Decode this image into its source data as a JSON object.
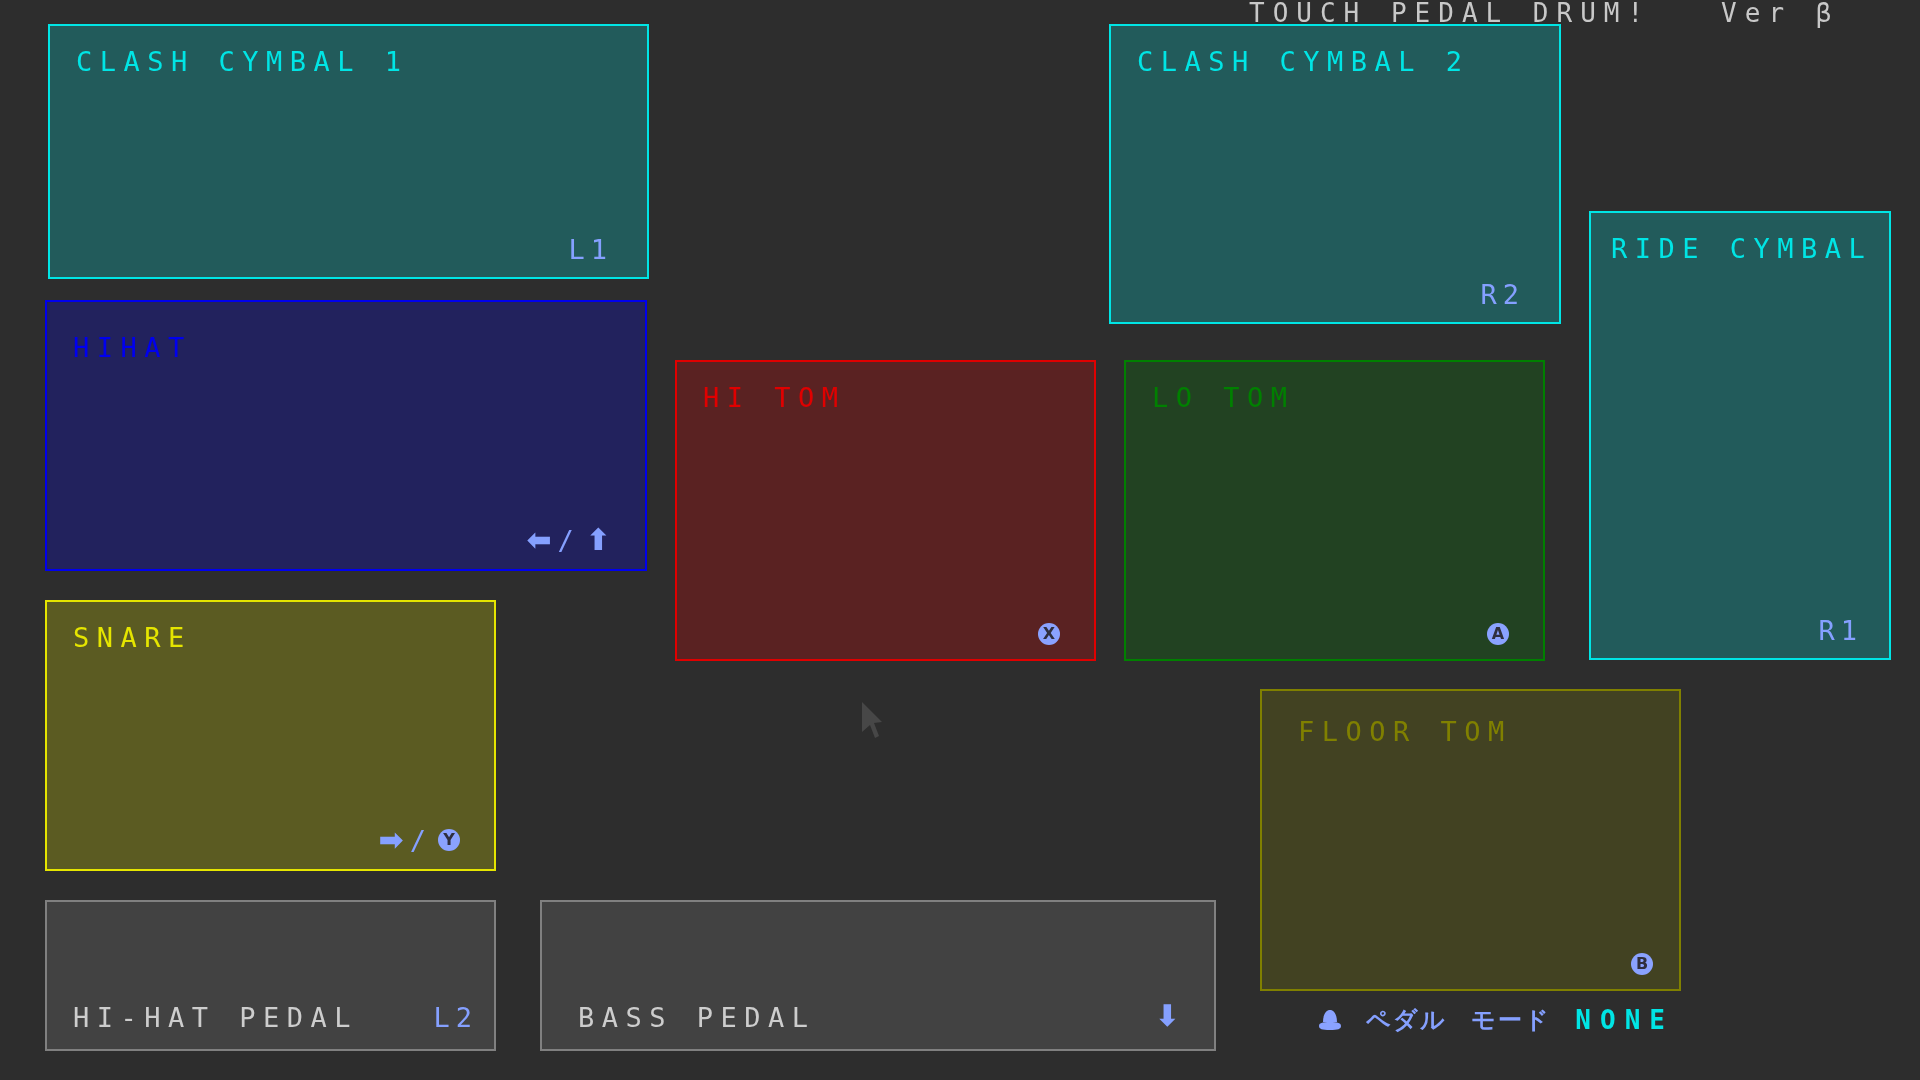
{
  "title": {
    "text": "TOUCH PEDAL DRUM!",
    "version": "Ver β"
  },
  "pads": [
    {
      "kind": "pad",
      "label": "CLASH CYMBAL 1",
      "color": "#00e5e5",
      "hints": [
        {
          "kind": "text",
          "text": "L1"
        }
      ]
    },
    {
      "kind": "pad",
      "label": "CLASH CYMBAL 2",
      "color": "#00e5e5",
      "hints": [
        {
          "kind": "text",
          "text": "R2"
        }
      ]
    },
    {
      "kind": "pad",
      "label": "HIHAT",
      "color": "#0000ee",
      "hints": [
        {
          "kind": "glyph",
          "text": "⬅"
        },
        {
          "kind": "text",
          "text": "/"
        },
        {
          "kind": "glyph",
          "text": "⬆"
        }
      ]
    },
    {
      "kind": "pad",
      "label": "HI TOM",
      "color": "#e00000",
      "hints": [
        {
          "kind": "button",
          "text": "X"
        }
      ]
    },
    {
      "kind": "pad",
      "label": "LO TOM",
      "color": "#008000",
      "hints": [
        {
          "kind": "button",
          "text": "A"
        }
      ]
    },
    {
      "kind": "pad",
      "label": "RIDE CYMBAL",
      "color": "#00e5e5",
      "hints": [
        {
          "kind": "text",
          "text": "R1"
        }
      ]
    },
    {
      "kind": "pad",
      "label": "SNARE",
      "color": "#e5e500",
      "hints": [
        {
          "kind": "glyph",
          "text": "➡"
        },
        {
          "kind": "text",
          "text": "/"
        },
        {
          "kind": "button",
          "text": "Y"
        }
      ]
    },
    {
      "kind": "pad",
      "label": "FLOOR TOM",
      "color": "#808000",
      "hints": [
        {
          "kind": "button",
          "text": "B"
        }
      ]
    },
    {
      "kind": "pedal",
      "label": "HI-HAT PEDAL",
      "color": "#808080",
      "hints": [
        {
          "kind": "text",
          "text": "L2"
        }
      ]
    },
    {
      "kind": "pedal",
      "label": "BASS PEDAL",
      "color": "#808080",
      "hints": [
        {
          "kind": "glyph",
          "text": "⬇"
        }
      ]
    }
  ],
  "pedal_mode": {
    "label": "ペダル モード",
    "value": "NONE"
  }
}
